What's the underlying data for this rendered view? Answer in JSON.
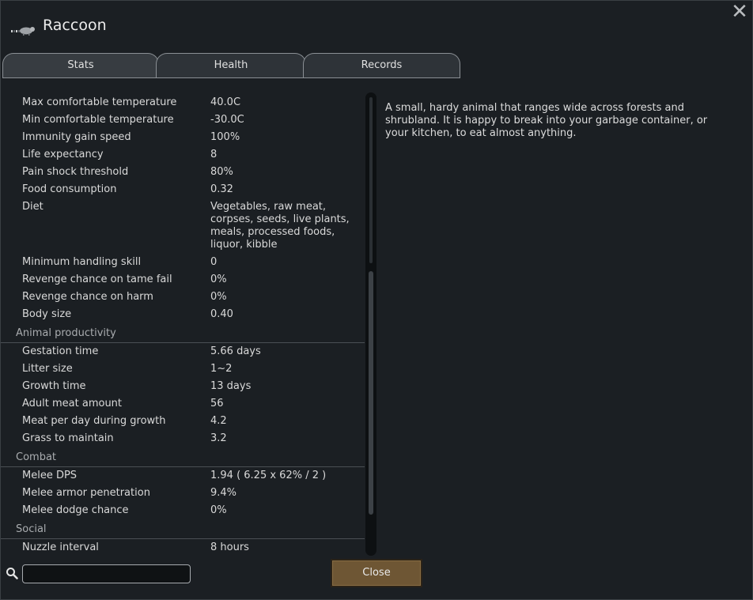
{
  "window": {
    "title": "Raccoon",
    "close_glyph": "✕"
  },
  "tabs": [
    {
      "label": "Stats",
      "active": true
    },
    {
      "label": "Health",
      "active": false
    },
    {
      "label": "Records",
      "active": false
    }
  ],
  "stats_top": [
    {
      "label": "Max comfortable temperature",
      "value": "40.0C"
    },
    {
      "label": "Min comfortable temperature",
      "value": "-30.0C"
    },
    {
      "label": "Immunity gain speed",
      "value": "100%"
    },
    {
      "label": "Life expectancy",
      "value": "8"
    },
    {
      "label": "Pain shock threshold",
      "value": "80%"
    },
    {
      "label": "Food consumption",
      "value": "0.32"
    },
    {
      "label": "Diet",
      "value": "Vegetables, raw meat, corpses, seeds, live plants, meals, processed foods, liquor, kibble"
    },
    {
      "label": "Minimum handling skill",
      "value": "0"
    },
    {
      "label": "Revenge chance on tame fail",
      "value": "0%"
    },
    {
      "label": "Revenge chance on harm",
      "value": "0%"
    },
    {
      "label": "Body size",
      "value": "0.40"
    }
  ],
  "sections": [
    {
      "title": "Animal productivity",
      "rows": [
        {
          "label": "Gestation time",
          "value": "5.66 days"
        },
        {
          "label": "Litter size",
          "value": "1~2"
        },
        {
          "label": "Growth time",
          "value": "13 days"
        },
        {
          "label": "Adult meat amount",
          "value": "56"
        },
        {
          "label": "Meat per day during growth",
          "value": "4.2"
        },
        {
          "label": "Grass to maintain",
          "value": "3.2"
        }
      ]
    },
    {
      "title": "Combat",
      "rows": [
        {
          "label": "Melee DPS",
          "value": "1.94 ( 6.25 x 62% / 2 )"
        },
        {
          "label": "Melee armor penetration",
          "value": "9.4%"
        },
        {
          "label": "Melee dodge chance",
          "value": "0%"
        }
      ]
    },
    {
      "title": "Social",
      "rows": [
        {
          "label": "Nuzzle interval",
          "value": "8 hours"
        }
      ]
    }
  ],
  "description": "A small, hardy animal that ranges wide across forests and shrubland. It is happy to break into your garbage container, or your kitchen, to eat almost anything.",
  "search": {
    "value": "",
    "placeholder": ""
  },
  "close_button": {
    "label": "Close"
  },
  "colors": {
    "button": "#6e5634",
    "background": "#1b1f23"
  }
}
